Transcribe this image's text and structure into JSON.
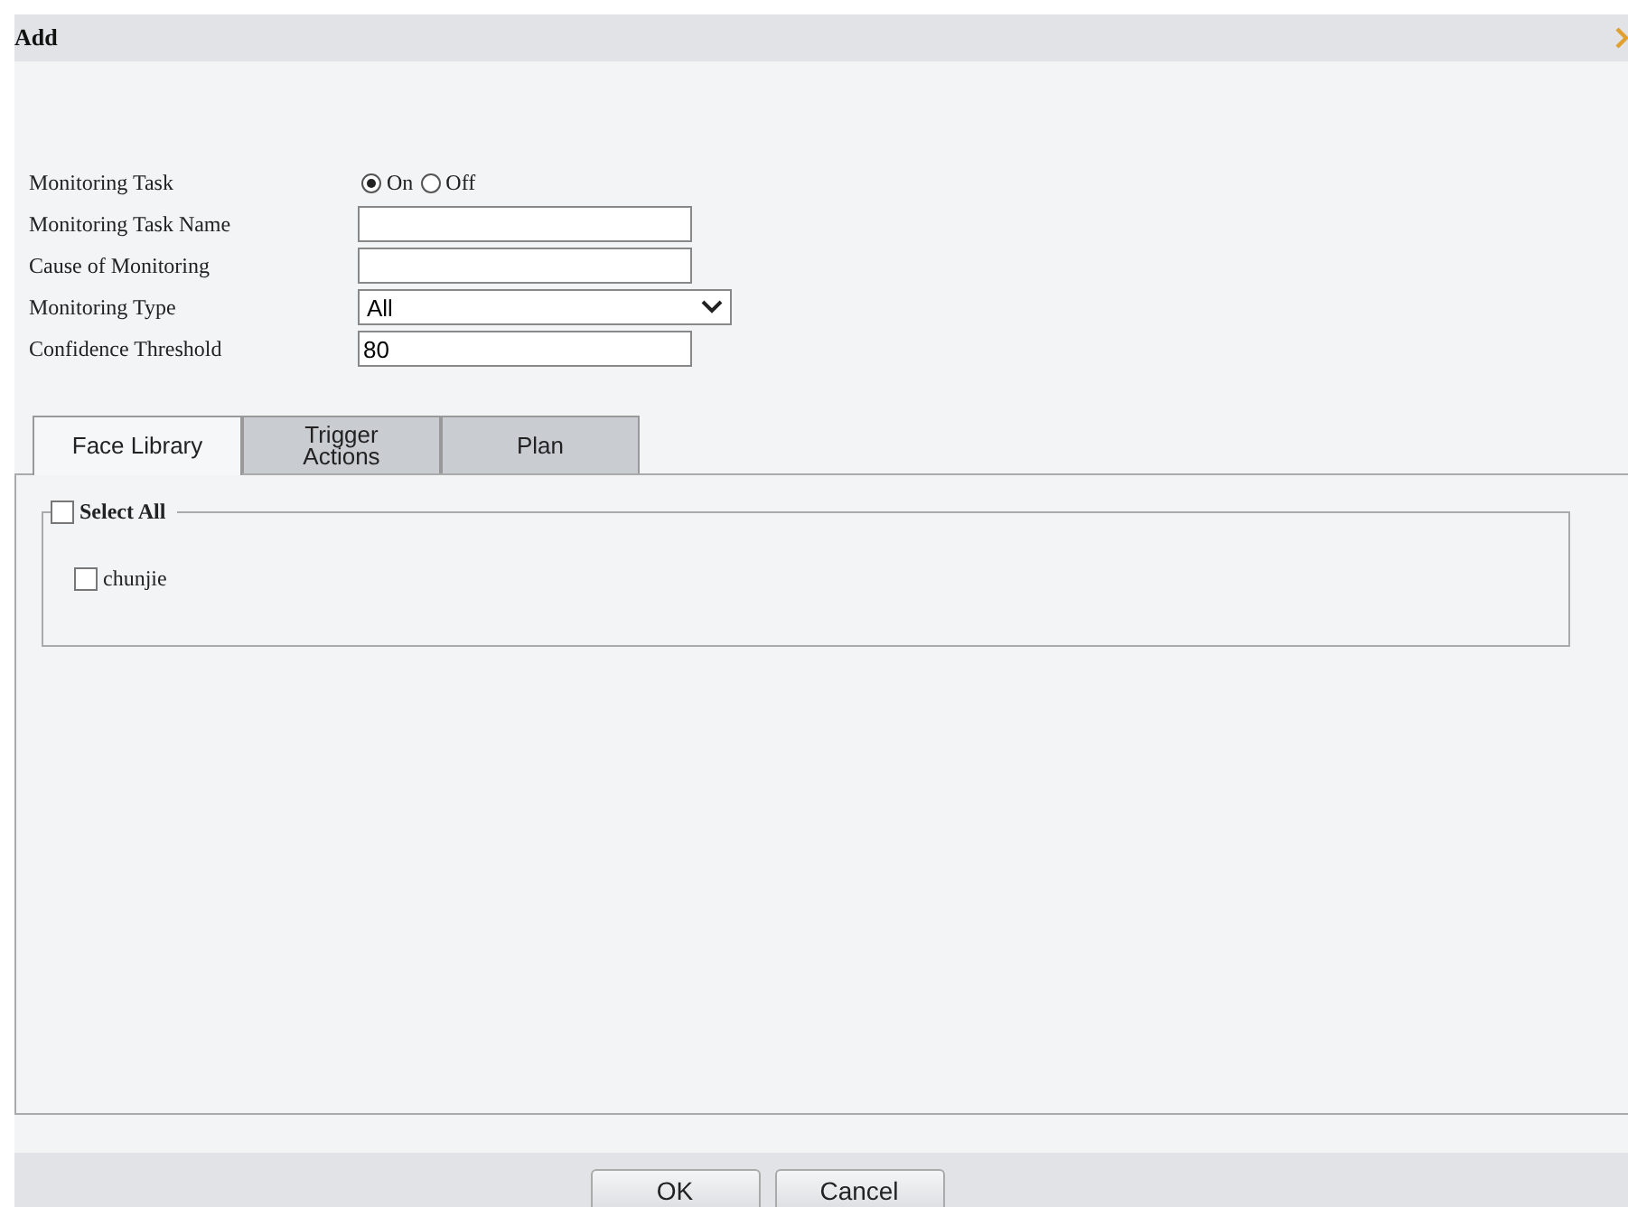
{
  "window": {
    "title": "Add"
  },
  "form": {
    "monitoring_task": {
      "label": "Monitoring Task",
      "options": [
        {
          "label": "On",
          "selected": true
        },
        {
          "label": "Off",
          "selected": false
        }
      ]
    },
    "fields": [
      {
        "kind": "text",
        "label": "Monitoring Task Name"
      },
      {
        "kind": "text",
        "label": "Cause of Monitoring"
      },
      {
        "kind": "select",
        "label": "Monitoring Type",
        "value": "All"
      },
      {
        "kind": "text",
        "label": "Confidence Threshold",
        "value": "80"
      }
    ]
  },
  "tabs": [
    {
      "label": "Face Library",
      "selected": true
    },
    {
      "label": "Trigger Actions",
      "selected": false
    },
    {
      "label": "Plan",
      "selected": false
    }
  ],
  "face_library": {
    "select_all": {
      "label": "Select All",
      "checked": false
    },
    "items": [
      {
        "label": "chunjie",
        "checked": false
      }
    ]
  },
  "buttons": [
    "OK",
    "Cancel"
  ]
}
